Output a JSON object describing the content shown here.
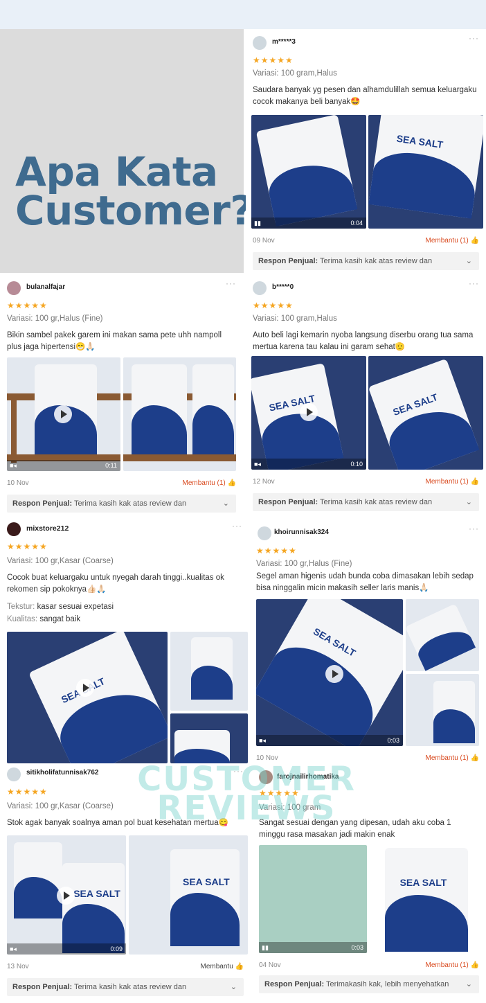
{
  "hero": {
    "title_line1": "Apa Kata",
    "title_line2": "Customer?"
  },
  "watermark": {
    "line1": "CUSTOMER",
    "line2": "REVIEWS"
  },
  "reviews": [
    {
      "user": "m*****3",
      "stars": "★★★★★",
      "variant": "Variasi: 100 gram,Halus",
      "text": "Saudara banyak yg pesen dan alhamdulillah semua keluargaku cocok makanya beli banyak🤩",
      "duration": "0:04",
      "date": "09 Nov",
      "helpful": "Membantu (1)",
      "reply_label": "Respon Penjual:",
      "reply_text": "Terima kasih kak atas review dan"
    },
    {
      "user": "bulanalfajar",
      "stars": "★★★★★",
      "variant": "Variasi: 100 gr,Halus (Fine)",
      "text": "Bikin sambel pakek garem ini makan sama pete uhh nampoll plus jaga hipertensi😁🙏🏻",
      "duration": "0:11",
      "date": "10 Nov",
      "helpful": "Membantu (1)",
      "reply_label": "Respon Penjual:",
      "reply_text": "Terima kasih kak atas review dan"
    },
    {
      "user": "b*****0",
      "stars": "★★★★★",
      "variant": "Variasi: 100 gram,Halus",
      "text": "Auto beli lagi kemarin nyoba langsung diserbu orang tua sama mertua karena tau kalau ini garam sehat🫡",
      "duration": "0:10",
      "date": "12 Nov",
      "helpful": "Membantu (1)",
      "reply_label": "Respon Penjual:",
      "reply_text": "Terima kasih kak atas review dan"
    },
    {
      "user": "mixstore212",
      "stars": "★★★★★",
      "variant": "Variasi: 100 gr,Kasar (Coarse)",
      "text": "Cocok buat keluargaku untuk nyegah darah tinggi..kualitas ok rekomen sip pokoknya👍🏻🙏🏻",
      "tekstur_label": "Tekstur:",
      "tekstur": "kasar sesuai expetasi",
      "kualitas_label": "Kualitas:",
      "kualitas": "sangat baik"
    },
    {
      "user": "khoirunnisak324",
      "stars": "★★★★★",
      "variant": "Variasi: 100 gr,Halus (Fine)",
      "text": "Segel aman higenis udah bunda coba dimasakan lebih sedap bisa ninggalin micin makasih seller laris manis🙏🏻",
      "duration": "0:03",
      "date": "10 Nov",
      "helpful": "Membantu (1)"
    },
    {
      "user": "sitikholifatunnisak762",
      "stars": "★★★★★",
      "variant": "Variasi: 100 gr,Kasar (Coarse)",
      "text": "Stok agak banyak soalnya aman pol buat kesehatan mertua😋",
      "duration": "0:09",
      "date": "13 Nov",
      "helpful": "Membantu",
      "reply_label": "Respon Penjual:",
      "reply_text": "Terima kasih kak atas review dan"
    },
    {
      "user": "farojnailirhomatika",
      "stars": "★★★★★",
      "variant": "Variasi: 100 gram",
      "text": "Sangat sesuai dengan yang dipesan, udah aku coba 1 minggu rasa masakan jadi makin enak",
      "duration": "0:03",
      "date": "04 Nov",
      "helpful": "Membantu (1)",
      "reply_label": "Respon Penjual:",
      "reply_text": "Terimakasih kak, lebih menyehatkan"
    }
  ],
  "product_label": "SEA SALT",
  "icons": {
    "thumb": "thumb-up-icon",
    "chevron": "chevron-down-icon",
    "more": "more-dots-icon",
    "play": "play-icon",
    "camera": "video-camera-icon"
  }
}
